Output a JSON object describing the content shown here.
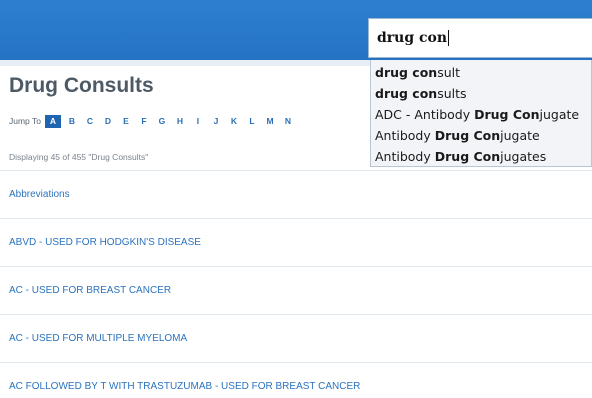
{
  "header": {
    "search": {
      "value": "drug con",
      "suggestions": [
        {
          "before": "",
          "bold": "drug con",
          "after": "sult"
        },
        {
          "before": "",
          "bold": "drug con",
          "after": "sults"
        },
        {
          "before": "ADC - Antibody ",
          "bold": "Drug Con",
          "after": "jugate"
        },
        {
          "before": "Antibody ",
          "bold": "Drug Con",
          "after": "jugate"
        },
        {
          "before": "Antibody ",
          "bold": "Drug Con",
          "after": "jugates"
        }
      ]
    }
  },
  "main": {
    "title": "Drug Consults",
    "jump_label": "Jump To",
    "letters": [
      "A",
      "B",
      "C",
      "D",
      "E",
      "F",
      "G",
      "H",
      "I",
      "J",
      "K",
      "L",
      "M",
      "N"
    ],
    "active_letter": "A",
    "displaying": "Displaying 45 of 455 \"Drug Consults\"",
    "items": [
      "Abbreviations",
      "ABVD - USED FOR HODGKIN'S DISEASE",
      "AC - USED FOR BREAST CANCER",
      "AC - USED FOR MULTIPLE MYELOMA",
      "AC FOLLOWED BY T WITH TRASTUZUMAB - USED FOR BREAST CANCER"
    ]
  },
  "colors": {
    "header_blue": "#2473c4",
    "link_blue": "#2b73bf",
    "title_gray": "#4d5a66"
  }
}
